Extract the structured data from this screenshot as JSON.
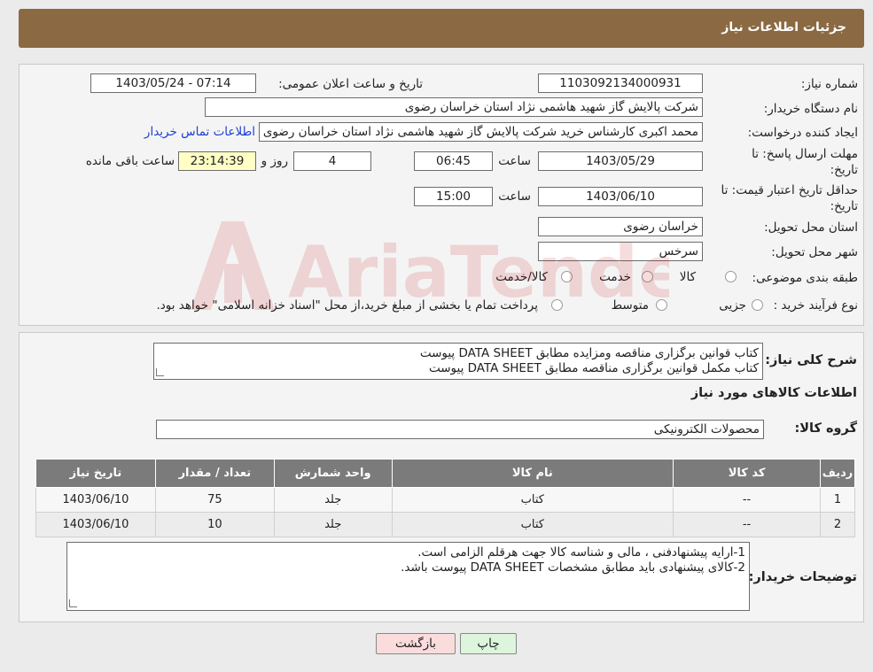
{
  "header": {
    "title": "جزئیات اطلاعات نیاز"
  },
  "fields": {
    "need_number_label": "شماره نیاز:",
    "need_number": "1103092134000931",
    "announce_label": "تاریخ و ساعت اعلان عمومی:",
    "announce_value": "1403/05/24 - 07:14",
    "buyer_org_label": "نام دستگاه خریدار:",
    "buyer_org": "شرکت پالایش گاز شهید هاشمی نژاد   استان خراسان رضوی",
    "creator_label": "ایجاد کننده درخواست:",
    "creator": "محمد اکبری کارشناس خرید شرکت پالایش گاز شهید هاشمی نژاد   استان خراسان رضوی",
    "contact_link": "اطلاعات تماس خریدار",
    "deadline_label_1": "مهلت ارسال پاسخ: تا",
    "deadline_label_2": "تاریخ:",
    "deadline_date": "1403/05/29",
    "time_label": "ساعت",
    "deadline_time": "06:45",
    "days_value": "4",
    "days_label": "روز و",
    "remaining_value": "23:14:39",
    "remaining_label": "ساعت باقی مانده",
    "validity_label_1": "حداقل تاریخ اعتبار قیمت: تا",
    "validity_label_2": "تاریخ:",
    "validity_date": "1403/06/10",
    "validity_time": "15:00",
    "province_label": "استان محل تحویل:",
    "province": "خراسان رضوی",
    "city_label": "شهر محل تحویل:",
    "city": "سرخس",
    "category_label": "طبقه بندی موضوعی:",
    "category_options": [
      "کالا",
      "خدمت",
      "کالا/خدمت"
    ],
    "process_label": "نوع فرآیند خرید :",
    "process_options": [
      "جزیی",
      "متوسط"
    ],
    "process_note": "پرداخت تمام یا بخشی از مبلغ خرید،از محل \"اسناد خزانه اسلامی\" خواهد بود."
  },
  "details": {
    "summary_label": "شرح کلی نیاز:",
    "summary_line1": "کتاب قوانین برگزاری مناقصه ومزایده مطابق DATA SHEET پیوست",
    "summary_line2": "کتاب مکمل  قوانین برگزاری مناقصه مطابق DATA SHEET پیوست",
    "goods_info_title": "اطلاعات کالاهای مورد نیاز",
    "goods_group_label": "گروه کالا:",
    "goods_group": "محصولات الکترونیکی"
  },
  "table": {
    "headers": [
      "ردیف",
      "کد کالا",
      "نام کالا",
      "واحد شمارش",
      "تعداد / مقدار",
      "تاریخ نیاز"
    ],
    "rows": [
      [
        "1",
        "--",
        "کتاب",
        "جلد",
        "75",
        "1403/06/10"
      ],
      [
        "2",
        "--",
        "کتاب",
        "جلد",
        "10",
        "1403/06/10"
      ]
    ]
  },
  "buyer_notes": {
    "label": "توضیحات خریدار:",
    "line1": "1-ارایه پیشنهادفنی ، مالی و شناسه کالا جهت هرقلم الزامی است.",
    "line2": "2-کالای پیشنهادی باید مطابق مشخصات DATA SHEET پیوست باشد."
  },
  "buttons": {
    "print": "چاپ",
    "back": "بازگشت"
  },
  "watermark": {
    "text": "AriaTender.neT"
  },
  "colors": {
    "header_bg": "#8b6a43",
    "link": "#1b3ed6",
    "highlight": "#ffffc5",
    "back_btn": "#fbdcdc",
    "print_btn": "#dcf5dc"
  }
}
